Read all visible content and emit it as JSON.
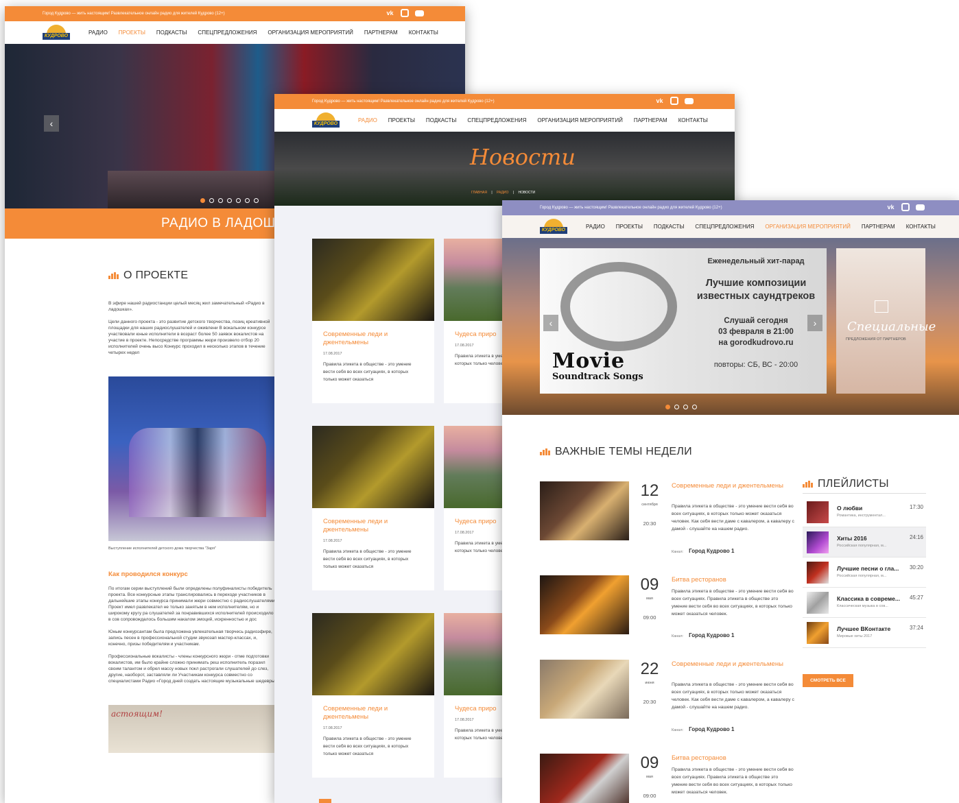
{
  "topbar_text": "Город Кудрово — жить настоящим! Развлекательное онлайн радио для жителей Кудрово (12+)",
  "logo_text": "КУДРОВО",
  "social": {
    "vk": "vk"
  },
  "menu": [
    "РАДИО",
    "ПРОЕКТЫ",
    "ПОДКАСТЫ",
    "СПЕЦПРЕДЛОЖЕНИЯ",
    "ОРГАНИЗАЦИЯ МЕРОПРИЯТИЙ",
    "ПАРТНЕРАМ",
    "КОНТАКТЫ"
  ],
  "page1": {
    "active_menu": "ПРОЕКТЫ",
    "banner_title": "РАДИО В ЛАДОШ",
    "section_title": "О ПРОЕКТЕ",
    "intro": "В эфире нашей радиостанции целый месяц жил замечательный «Радио в ладошках».",
    "p1": "Цели данного проекта - это развитие детского творчества, позиц креативной площадки для наших радиослушателей и оживлени В вокальном конкурсе участвовали юные исполнители в возраст более 50 заявок вокалистов на участие в проекте. Непосредстве программы жюри произвело отбор 20 исполнителей очень высо Конкурс проходил в несколько этапов в течение четырех недел",
    "caption": "Выступление исполнителей детского дома творчества \"Заря\"",
    "subheading": "Как проводился конкурс",
    "p2": "По итогам серии выступлений были определены полуфиналисты победитель проекта. Все конкурсные этапы транслировались в переходе участников в дальнейшие этапы конкурса принимали жюри совместно с радиослушателями. Проект имел развлекател не только занятым в нем исполнителям, но и широкому кругу ра слушателей за понравившихся исполнителей происходило в сов сопровождалось большим накалом эмоций, искренностью и дос",
    "p3": "Юным конкурсантам была предложена увлекательная творчесь радиоэфире, запись песен в профессиональной студии звукозап мастер-классах, и, конечно, призы победителям и участникам.",
    "p4": "Профессиональные вокалисты - члены конкурсного жюри - отме подготовки вокалистов, им было крайне сложно принимать реш исполнитель поразил своим талантом и обрел массу новых покл растрогали слушателей до слез, другие, наоборот, заставляли ли Участникам конкурса совместно со специалистами Радио «Город дней создать настоящие музыкальные шедевры!",
    "bottom_img_text": "астоящим!"
  },
  "page2": {
    "active_menu": "РАДИО",
    "hero_title": "Новости",
    "breadcrumb": [
      "ГЛАВНАЯ",
      "РАДИО",
      "НОВОСТИ"
    ],
    "card_left": {
      "title": "Современные леди и джентельмены",
      "date": "17.08.2017",
      "text": "Правила этикета в обществе - это умение вести себя во всех ситуациях, в которых только может оказаться"
    },
    "card_right": {
      "title": "Чудеса приро",
      "date": "17.08.2017",
      "text": "Правила этикета в умение вести себя в которых только человек. Как себя"
    }
  },
  "page3": {
    "active_menu": "ОРГАНИЗАЦИЯ МЕРОПРИЯТИЙ",
    "slide": {
      "l1": "Еженедельный хит-парад",
      "l2": "Лучшие композиции",
      "l3": "известных саундтреков",
      "l4": "Слушай сегодня",
      "l5": "03 февраля в 21:00",
      "l6": "на gorodkudrovo.ru",
      "l7": "повторы: СБ, ВС - 20:00",
      "movie1": "Movie",
      "movie2": "Soundtrack Songs",
      "side_title": "Специальные",
      "side_sub": "ПРЕДЛОЖЕНИЯ ОТ ПАРТНЕРОВ"
    },
    "section_title": "ВАЖНЫЕ ТЕМЫ НЕДЕЛИ",
    "news": [
      {
        "day": "12",
        "month": "сентября",
        "time": "20:30",
        "title": "Современные леди и джентельмены",
        "text": "Правила этикета в обществе - это умение вести себя во всех ситуациях, в которых только может оказаться человек. Как себя вести даме с кавалером, а кавалеру с дамой - слушайте на нашем радио.",
        "ch_label": "Канал:",
        "channel": "Город Кудрово 1"
      },
      {
        "day": "09",
        "month": "мая",
        "time": "09:00",
        "title": "Битва ресторанов",
        "text": "Правила этикета в обществе - это умение вести себя во всех ситуациях. Правила этикета в обществе это умение вести себя во всех ситуациях, в которых только может оказаться человек.",
        "ch_label": "Канал:",
        "channel": "Город Кудрово 1"
      },
      {
        "day": "22",
        "month": "июня",
        "time": "20:30",
        "title": "Современные леди и джентельмены",
        "text": "Правила этикета в обществе - это умение вести себя во всех ситуациях, в которых только может оказаться человек. Как себя вести даме с кавалером, а кавалеру с дамой - слушайте на нашем радио.",
        "ch_label": "Канал:",
        "channel": "Город Кудрово 1"
      },
      {
        "day": "09",
        "month": "мая",
        "time": "09:00",
        "title": "Битва ресторанов",
        "text": "Правила этикета в обществе - это умение вести себя во всех ситуациях. Правила этикета в обществе это умение вести себя во всех ситуациях, в которых только может оказаться человек.",
        "ch_label": "",
        "channel": ""
      }
    ],
    "playlists_title": "ПЛЕЙЛИСТЫ",
    "playlists": [
      {
        "name": "О любви",
        "sub": "Романтика, инструментал...",
        "dur": "17:30"
      },
      {
        "name": "Хиты 2016",
        "sub": "Российская популярная, м...",
        "dur": "24:16"
      },
      {
        "name": "Лучшие песни о гла...",
        "sub": "Российская популярная, м...",
        "dur": "30:20"
      },
      {
        "name": "Классика в совреме...",
        "sub": "Классическая музыка в сов...",
        "dur": "45:27"
      },
      {
        "name": "Лучшее ВКонтакте",
        "sub": "Мировые хиты 2017",
        "dur": "37:24"
      }
    ],
    "see_all": "СМОТРЕТЬ ВСЕ"
  }
}
